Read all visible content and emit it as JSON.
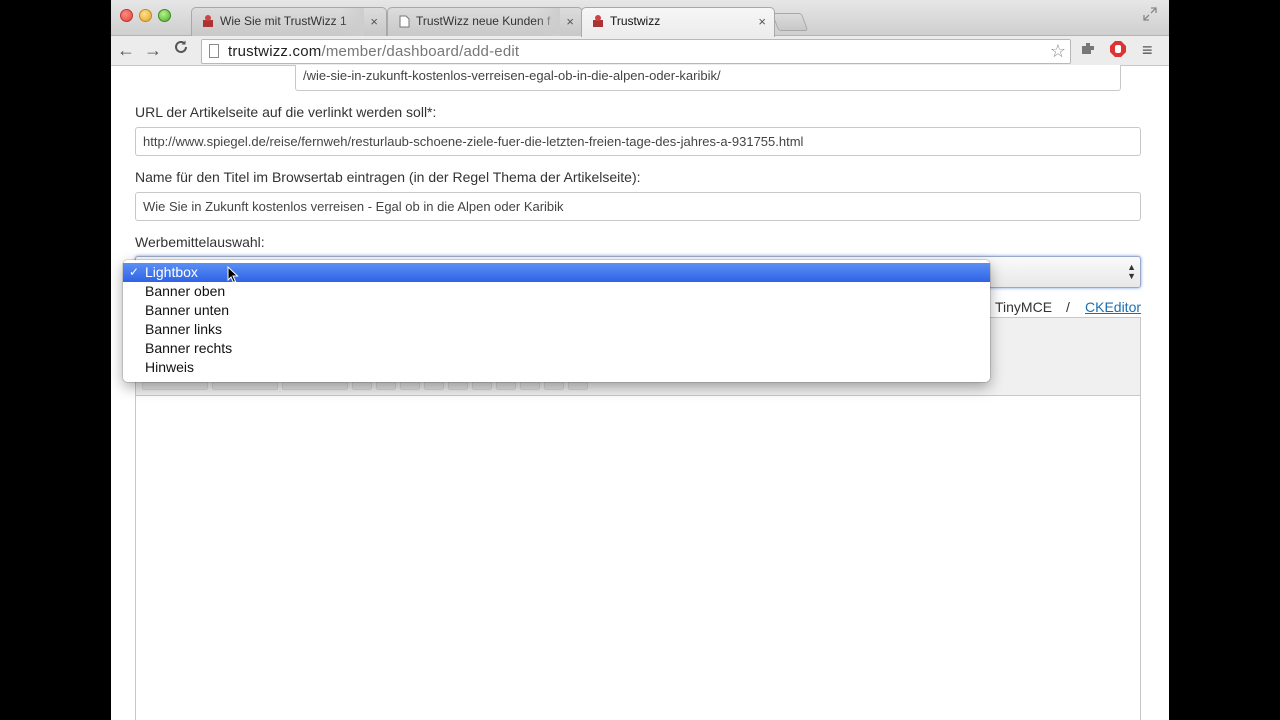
{
  "browser": {
    "tabs": [
      {
        "title": "Wie Sie mit TrustWizz 1",
        "close": "×",
        "favicon": "trustwizz-favicon-icon"
      },
      {
        "title": "TrustWizz neue Kunden f",
        "close": "×",
        "favicon": "page-icon"
      },
      {
        "title": "Trustwizz",
        "close": "×",
        "favicon": "trustwizz-favicon-icon"
      }
    ],
    "url_host": "trustwizz.com",
    "url_path": "/member/dashboard/add-edit",
    "back": "←",
    "forward": "→",
    "reload": "C",
    "star": "☆",
    "menu": "≡"
  },
  "form": {
    "article_path_value": "/wie-sie-in-zukunft-kostenlos-verreisen-egal-ob-in-die-alpen-oder-karibik/",
    "target_url_label": "URL der Artikelseite auf die verlinkt werden soll*:",
    "target_url_value": "http://www.spiegel.de/reise/fernweh/resturlaub-schoene-ziele-fuer-die-letzten-freien-tage-des-jahres-a-931755.html",
    "tab_title_label": "Name für den Titel im Browsertab eintragen (in der Regel Thema der Artikelseite):",
    "tab_title_value": "Wie Sie in Zukunft kostenlos verreisen - Egal ob in die Alpen oder Karibik",
    "ad_select_label": "Werbemittelauswahl:",
    "ad_select_options": [
      "Lightbox",
      "Banner oben",
      "Banner unten",
      "Banner links",
      "Banner rechts",
      "Hinweis"
    ],
    "ad_select_selected": "Lightbox",
    "check_mark": "✓",
    "editor_tinymce": "TinyMCE",
    "editor_separator": "/",
    "editor_ckeditor": "CKEditor"
  }
}
